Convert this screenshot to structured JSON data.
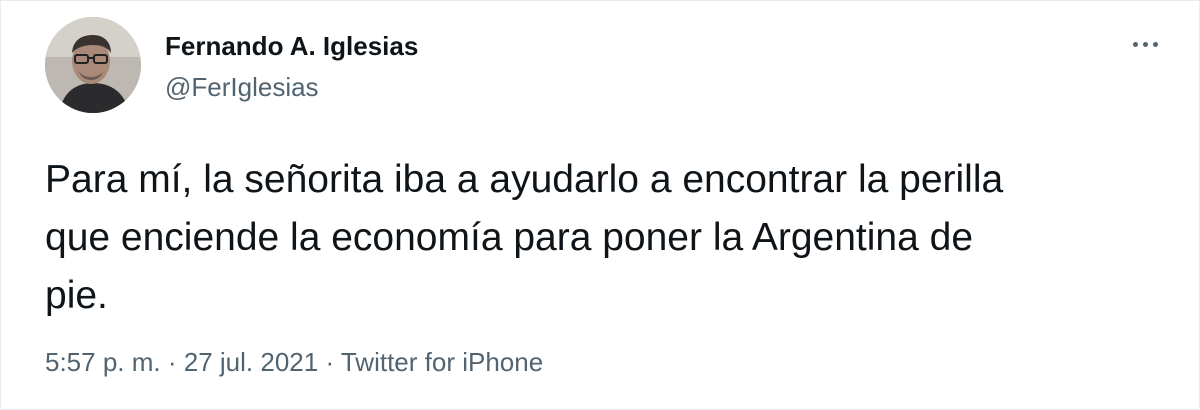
{
  "tweet": {
    "author": {
      "name": "Fernando A. Iglesias",
      "handle": "@FerIglesias"
    },
    "text_lines": [
      "Para mí, la señorita iba a ayudarlo a encontrar la perilla",
      "que enciende la economía para poner la Argentina de",
      "pie."
    ],
    "time": "5:57 p. m.",
    "separator": "·",
    "date": "27 jul. 2021",
    "source": "Twitter for iPhone"
  },
  "icons": {
    "more": "more-options-icon"
  },
  "colors": {
    "text_primary": "#0f1419",
    "text_secondary": "#536471",
    "background": "#ffffff"
  }
}
